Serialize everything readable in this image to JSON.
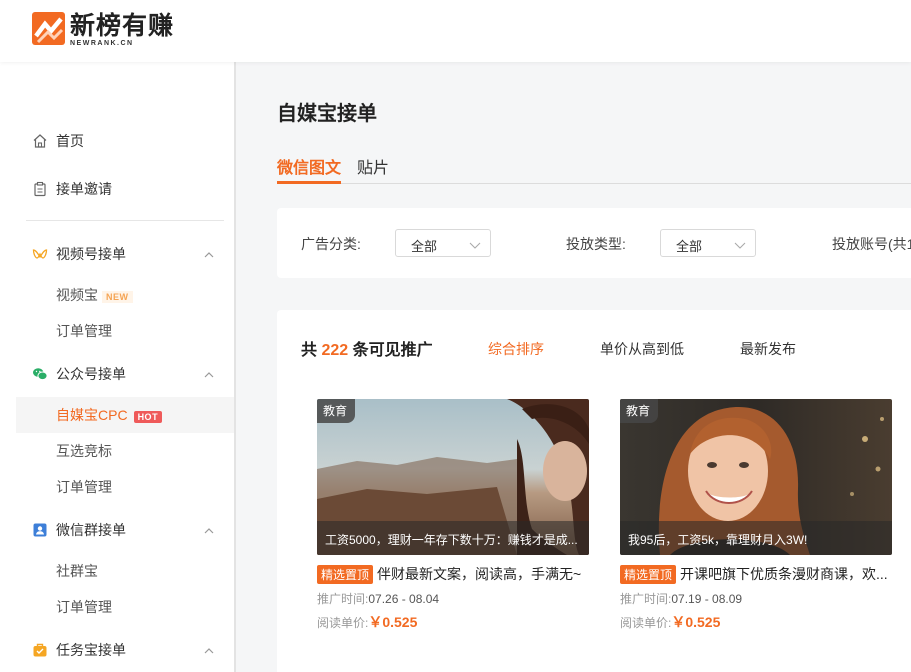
{
  "header": {
    "logo_cn": "新榜有赚",
    "logo_en": "NEWRANK.CN",
    "brand_color": "#f26a22"
  },
  "sidebar": {
    "home": "首页",
    "invite": "接单邀请",
    "video_group": "视频号接单",
    "video_sub1": "视频宝",
    "video_sub1_badge": "NEW",
    "video_sub2": "订单管理",
    "mp_group": "公众号接单",
    "mp_sub1": "自媒宝CPC",
    "mp_sub1_badge": "HOT",
    "mp_sub2": "互选竞标",
    "mp_sub3": "订单管理",
    "wxgroup_group": "微信群接单",
    "wxgroup_sub1": "社群宝",
    "wxgroup_sub2": "订单管理",
    "task_group": "任务宝接单"
  },
  "main": {
    "title": "自媒宝接单",
    "tabs": [
      "微信图文",
      "贴片"
    ],
    "filters": {
      "ad_category_label": "广告分类:",
      "ad_category_value": "全部",
      "delivery_type_label": "投放类型:",
      "delivery_type_value": "全部",
      "account_label": "投放账号(共1"
    },
    "list": {
      "count_prefix": "共",
      "count": "222",
      "count_suffix": "条可见推广",
      "sorts": [
        "综合排序",
        "单价从高到低",
        "最新发布"
      ],
      "cards": [
        {
          "tag": "教育",
          "overlay": "工资5000，理财一年存下数十万：赚钱才是成...",
          "pin": "精选置顶",
          "title": "伴财最新文案，阅读高，手满无~",
          "time_label": "推广时间:",
          "time": "07.26 - 08.04",
          "price_label": "阅读单价:",
          "price": "￥0.525"
        },
        {
          "tag": "教育",
          "overlay": "我95后，工资5k，靠理财月入3W!",
          "pin": "精选置顶",
          "title": "开课吧旗下优质条漫财商课，欢...",
          "time_label": "推广时间:",
          "time": "07.19 - 08.09",
          "price_label": "阅读单价:",
          "price": "￥0.525"
        }
      ]
    }
  }
}
